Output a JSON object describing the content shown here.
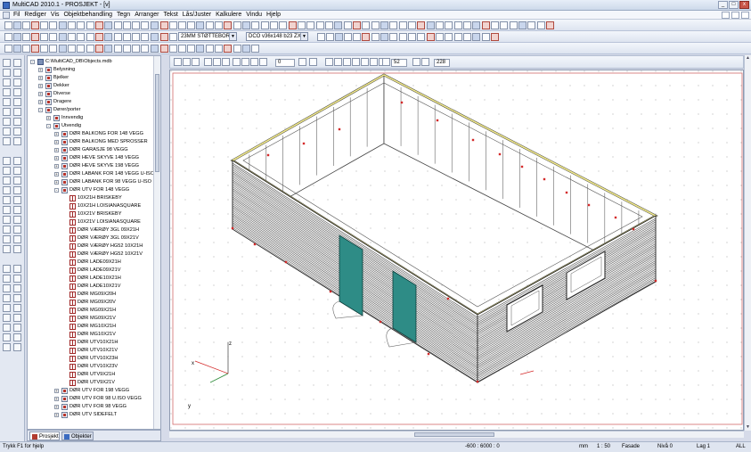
{
  "title": "MultiCAD 2010.1 - PROSJEKT - [v]",
  "window_buttons": {
    "min": "_",
    "max": "□",
    "close": "x"
  },
  "menu": [
    "Fil",
    "Rediger",
    "Vis",
    "Objektbehandling",
    "Tegn",
    "Arranger",
    "Tekst",
    "Lås/Juster",
    "Kalkulere",
    "Vindu",
    "Hjelp"
  ],
  "toolbar": {
    "wall_combo": "23MM STØTTEBORD",
    "profile_combo": "DCO v36x148 b23 ZX"
  },
  "draw_toolbar": {
    "angle": "0",
    "zoom": "52",
    "scale": "228"
  },
  "tree": {
    "items": [
      {
        "label": "C:\\MultiCAD_DB\\Objects.mdb",
        "level": 0,
        "box": "-",
        "icon": "db"
      },
      {
        "label": "Belysning",
        "level": 1,
        "box": "+",
        "icon": "fold"
      },
      {
        "label": "Bjelker",
        "level": 1,
        "box": "+",
        "icon": "fold"
      },
      {
        "label": "Dekker",
        "level": 1,
        "box": "+",
        "icon": "fold"
      },
      {
        "label": "Diverse",
        "level": 1,
        "box": "+",
        "icon": "fold"
      },
      {
        "label": "Dragere",
        "level": 1,
        "box": "+",
        "icon": "fold"
      },
      {
        "label": "Dører/porter",
        "level": 1,
        "box": "-",
        "icon": "fold"
      },
      {
        "label": "Innvendig",
        "level": 2,
        "box": "+",
        "icon": "fold"
      },
      {
        "label": "Utvendig",
        "level": 2,
        "box": "-",
        "icon": "fold"
      },
      {
        "label": "DØR BALKONG FOR 148 VEGG",
        "level": 3,
        "box": "+",
        "icon": "fold"
      },
      {
        "label": "DØR BALKONG MED SPROSSER",
        "level": 3,
        "box": "+",
        "icon": "fold"
      },
      {
        "label": "DØR GARASJE 98 VEGG",
        "level": 3,
        "box": "+",
        "icon": "fold"
      },
      {
        "label": "DØR HEVE SKYVE 148 VEGG",
        "level": 3,
        "box": "+",
        "icon": "fold"
      },
      {
        "label": "DØR HEVE SKYVE 198 VEGG",
        "level": 3,
        "box": "+",
        "icon": "fold"
      },
      {
        "label": "DØR LABANK FOR 148 VEGG U-ISO",
        "level": 3,
        "box": "+",
        "icon": "fold"
      },
      {
        "label": "DØR LABANK FOR 98 VEGG U-ISO",
        "level": 3,
        "box": "+",
        "icon": "fold"
      },
      {
        "label": "DØR UTV FOR 148 VEGG",
        "level": 3,
        "box": "-",
        "icon": "fold"
      },
      {
        "label": "10X21H BRISKEBY",
        "level": 4,
        "box": "",
        "icon": "obj"
      },
      {
        "label": "10X21H LOISIANASQUARE",
        "level": 4,
        "box": "",
        "icon": "obj"
      },
      {
        "label": "10X21V BRISKEBY",
        "level": 4,
        "box": "",
        "icon": "obj"
      },
      {
        "label": "10X21V LOISIANASQUARE",
        "level": 4,
        "box": "",
        "icon": "obj"
      },
      {
        "label": "DØR VÆRØY 3GL 09X21H",
        "level": 4,
        "box": "",
        "icon": "obj"
      },
      {
        "label": "DØR VÆRØY 3GL 09X21V",
        "level": 4,
        "box": "",
        "icon": "obj"
      },
      {
        "label": "DØR VÆRØY HG52 10X21H",
        "level": 4,
        "box": "",
        "icon": "obj"
      },
      {
        "label": "DØR VÆRØY HG52 10X21V",
        "level": 4,
        "box": "",
        "icon": "obj"
      },
      {
        "label": "DØR LADE09X21H",
        "level": 4,
        "box": "",
        "icon": "obj"
      },
      {
        "label": "DØR LADE09X21V",
        "level": 4,
        "box": "",
        "icon": "obj"
      },
      {
        "label": "DØR LADE10X21H",
        "level": 4,
        "box": "",
        "icon": "obj"
      },
      {
        "label": "DØR LADE10X21V",
        "level": 4,
        "box": "",
        "icon": "obj"
      },
      {
        "label": "DØR MG09X20H",
        "level": 4,
        "box": "",
        "icon": "obj"
      },
      {
        "label": "DØR MG09X20V",
        "level": 4,
        "box": "",
        "icon": "obj"
      },
      {
        "label": "DØR MG09X21H",
        "level": 4,
        "box": "",
        "icon": "obj"
      },
      {
        "label": "DØR MG09X21V",
        "level": 4,
        "box": "",
        "icon": "obj"
      },
      {
        "label": "DØR MG10X21H",
        "level": 4,
        "box": "",
        "icon": "obj"
      },
      {
        "label": "DØR MG10X21V",
        "level": 4,
        "box": "",
        "icon": "obj"
      },
      {
        "label": "DØR UTV10X21H",
        "level": 4,
        "box": "",
        "icon": "obj"
      },
      {
        "label": "DØR UTV10X21V",
        "level": 4,
        "box": "",
        "icon": "obj"
      },
      {
        "label": "DØR UTV10X23H",
        "level": 4,
        "box": "",
        "icon": "obj"
      },
      {
        "label": "DØR UTV10X23V",
        "level": 4,
        "box": "",
        "icon": "obj"
      },
      {
        "label": "DØR UTV9X21H",
        "level": 4,
        "box": "",
        "icon": "obj"
      },
      {
        "label": "DØR UTV9X21V",
        "level": 4,
        "box": "",
        "icon": "obj"
      },
      {
        "label": "DØR UTV FOR 198 VEGG",
        "level": 3,
        "box": "+",
        "icon": "fold"
      },
      {
        "label": "DØR UTV FOR 98 U.ISO VEGG",
        "level": 3,
        "box": "+",
        "icon": "fold"
      },
      {
        "label": "DØR UTV FOR 98 VEGG",
        "level": 3,
        "box": "+",
        "icon": "fold"
      },
      {
        "label": "DØR UTV SIDEFELT",
        "level": 3,
        "box": "+",
        "icon": "fold"
      }
    ]
  },
  "tabs": {
    "projekt": "Prosjekt",
    "objekter": "Objekter"
  },
  "axes": {
    "x": "x",
    "y": "y",
    "z": "z"
  },
  "status": {
    "help": "Trykk F1 for hjelp",
    "coords": "-600 : 6000 : 0",
    "unit": "mm",
    "scale": "1 : 50",
    "view": "Fasade",
    "level": "Nivå 0",
    "layer": "Lag 1",
    "filter": "ALL"
  },
  "colors": {
    "door": "#2e8c86",
    "plate": "#f0e88a",
    "frame": "#c83030"
  }
}
